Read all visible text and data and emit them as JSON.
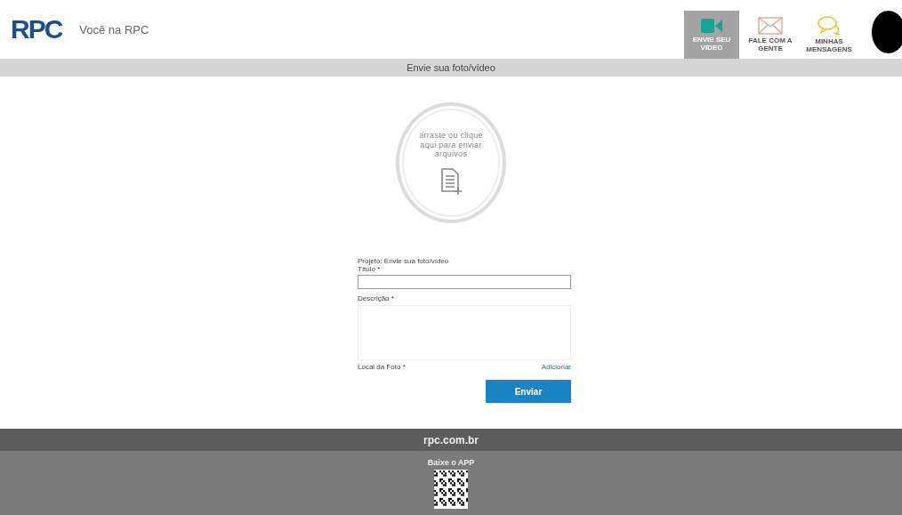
{
  "header": {
    "logo": "RPC",
    "tagline": "Você na RPC",
    "nav": [
      {
        "kind": "video",
        "label": "ENVIE SEU VIDEO",
        "selected": true
      },
      {
        "kind": "mail",
        "label": "FALE COM A GENTE",
        "selected": false
      },
      {
        "kind": "chat",
        "label": "MINHAS MENSAGENS",
        "selected": false
      }
    ]
  },
  "page_title": "Envie sua foto/vídeo",
  "upload": {
    "hint": "arraste ou clique aqui para enviar arquivos"
  },
  "form": {
    "project": "Projeto: Envie sua foto/vídeo",
    "title_label": "Título *",
    "description_label": "Descrição *",
    "location_label": "Local da Foto *",
    "add_link": "Adicionar",
    "submit": "Enviar"
  },
  "footer": {
    "site": "rpc.com.br",
    "app_label": "Baixe o APP"
  }
}
